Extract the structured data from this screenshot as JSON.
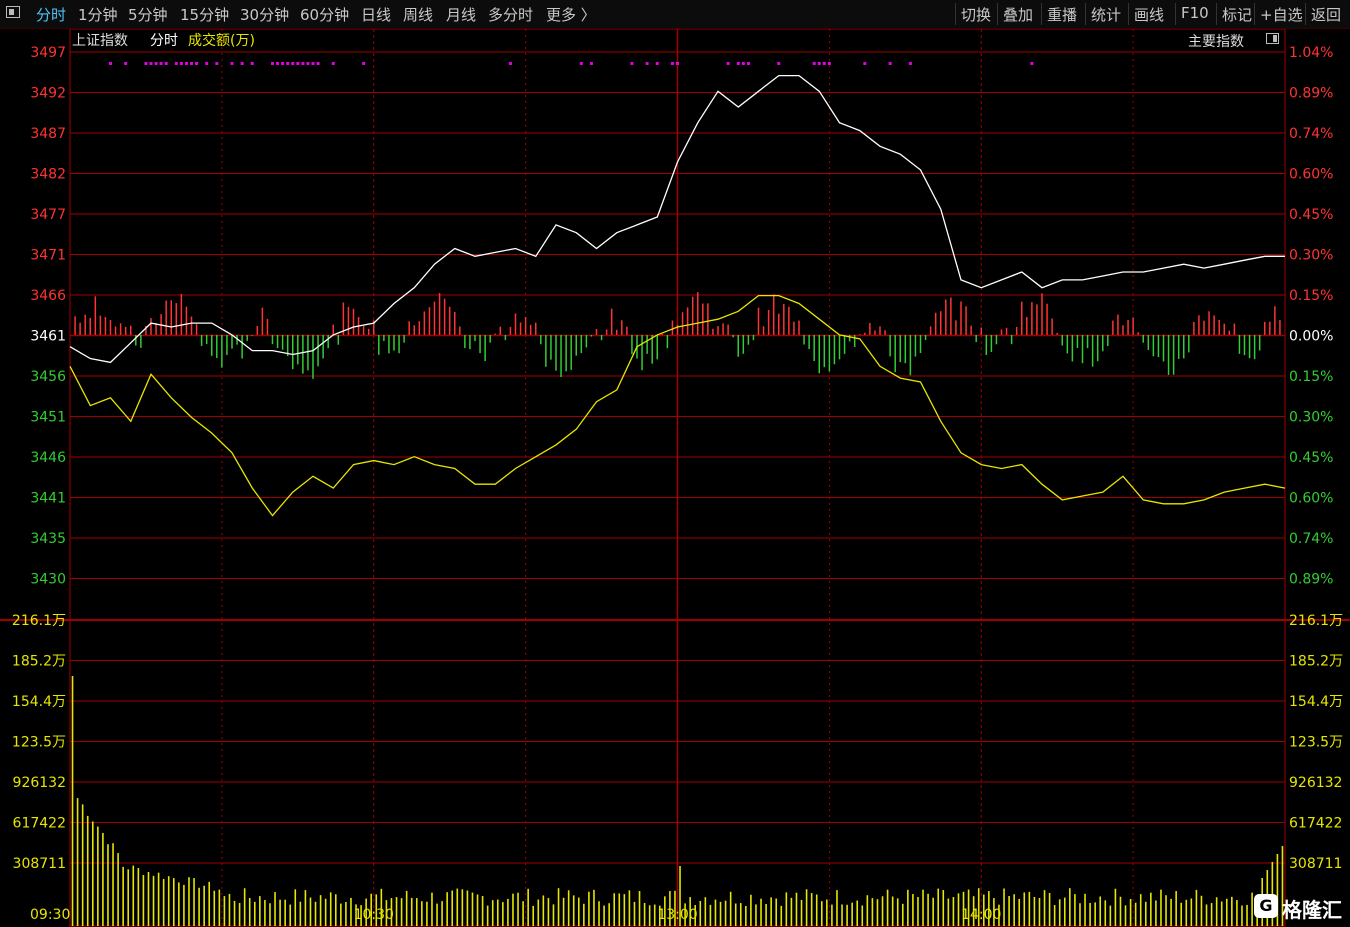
{
  "toolbar": {
    "left_items": [
      "分时",
      "1分钟",
      "5分钟",
      "15分钟",
      "30分钟",
      "60分钟",
      "日线",
      "周线",
      "月线",
      "多分时",
      "更多 〉"
    ],
    "active_index": 0,
    "right_items": [
      "切换",
      "叠加",
      "重播",
      "统计",
      "画线",
      "F10",
      "标记",
      "+自选",
      "返回"
    ]
  },
  "info": {
    "index_name": "上证指数",
    "mode": "分时",
    "series_label": "成交额(万)",
    "main_index_label": "主要指数"
  },
  "colors": {
    "up": "#ff3333",
    "down": "#33cc33",
    "price_line": "#ffffff",
    "avg_line": "#e6e600",
    "volume": "#e6e600",
    "grid": "#a00000",
    "marker": "#e000e0",
    "axis_neutral": "#ffffff"
  },
  "chart_data": {
    "type": "line",
    "title": "上证指数 分时",
    "prev_close": 3461,
    "price_axis": {
      "ticks": [
        3497,
        3492,
        3487,
        3482,
        3477,
        3471,
        3466,
        3461,
        3456,
        3451,
        3446,
        3441,
        3435,
        3430
      ],
      "ylim": [
        3430,
        3497
      ]
    },
    "pct_axis": {
      "ticks": [
        "1.04%",
        "0.89%",
        "0.74%",
        "0.60%",
        "0.45%",
        "0.30%",
        "0.15%",
        "0.00%",
        "0.15%",
        "0.30%",
        "0.45%",
        "0.60%",
        "0.74%",
        "0.89%"
      ]
    },
    "volume_axis": {
      "ticks": [
        "216.1万",
        "185.2万",
        "154.4万",
        "123.5万",
        "926132",
        "617422",
        "308711"
      ]
    },
    "x_ticks": [
      "09:30",
      "10:30",
      "13:00",
      "14:00"
    ],
    "series": [
      {
        "name": "上证指数",
        "x": [
          0,
          4,
          8,
          12,
          16,
          20,
          24,
          28,
          32,
          36,
          40,
          44,
          48,
          52,
          56,
          60,
          64,
          68,
          72,
          76,
          80,
          84,
          88,
          92,
          96,
          100,
          104,
          108,
          112,
          116,
          120,
          124,
          128,
          132,
          136,
          140,
          144,
          148,
          152,
          156,
          160,
          164,
          168,
          172,
          176,
          180,
          184,
          188,
          192,
          196,
          200,
          204,
          208,
          212,
          216,
          220,
          224,
          228,
          232,
          236,
          240
        ],
        "values": [
          3459.5,
          3458,
          3457.5,
          3460,
          3462.5,
          3462,
          3462.5,
          3462.5,
          3461,
          3459,
          3459,
          3458.5,
          3459,
          3461,
          3462,
          3462.5,
          3465,
          3467,
          3470,
          3472,
          3471,
          3471.5,
          3472,
          3471,
          3475,
          3474,
          3472,
          3474,
          3475,
          3476,
          3483,
          3488,
          3492,
          3490,
          3492,
          3494,
          3494,
          3492,
          3488,
          3487,
          3485,
          3484,
          3482,
          3477,
          3468,
          3467,
          3468,
          3469,
          3467,
          3468,
          3468,
          3468.5,
          3469,
          3469,
          3469.5,
          3470,
          3469.5,
          3470,
          3470.5,
          3471,
          3471
        ]
      },
      {
        "name": "均价",
        "x": [
          0,
          4,
          8,
          12,
          16,
          20,
          24,
          28,
          32,
          36,
          40,
          44,
          48,
          52,
          56,
          60,
          64,
          68,
          72,
          76,
          80,
          84,
          88,
          92,
          96,
          100,
          104,
          108,
          112,
          116,
          120,
          124,
          128,
          132,
          136,
          140,
          144,
          148,
          152,
          156,
          160,
          164,
          168,
          172,
          176,
          180,
          184,
          188,
          192,
          196,
          200,
          204,
          208,
          212,
          216,
          220,
          224,
          228,
          232,
          236,
          240
        ],
        "values": [
          3457,
          3452,
          3453,
          3450,
          3456,
          3453,
          3450.5,
          3448.5,
          3446,
          3441.5,
          3438,
          3441,
          3443,
          3441.5,
          3444.5,
          3445,
          3444.5,
          3445.5,
          3444.5,
          3444,
          3442,
          3442,
          3444,
          3445.5,
          3447,
          3449,
          3452.5,
          3454,
          3459.5,
          3461,
          3462,
          3462.5,
          3463,
          3464,
          3466,
          3466,
          3465,
          3463,
          3461,
          3460.5,
          3457,
          3455.5,
          3455,
          3450,
          3446,
          3444.5,
          3444,
          3444.5,
          3442,
          3440,
          3440.5,
          3441,
          3443,
          3440,
          3439.5,
          3439.5,
          3440,
          3441,
          3441.5,
          3442,
          3441.5
        ]
      }
    ],
    "xlim": [
      0,
      240
    ]
  }
}
